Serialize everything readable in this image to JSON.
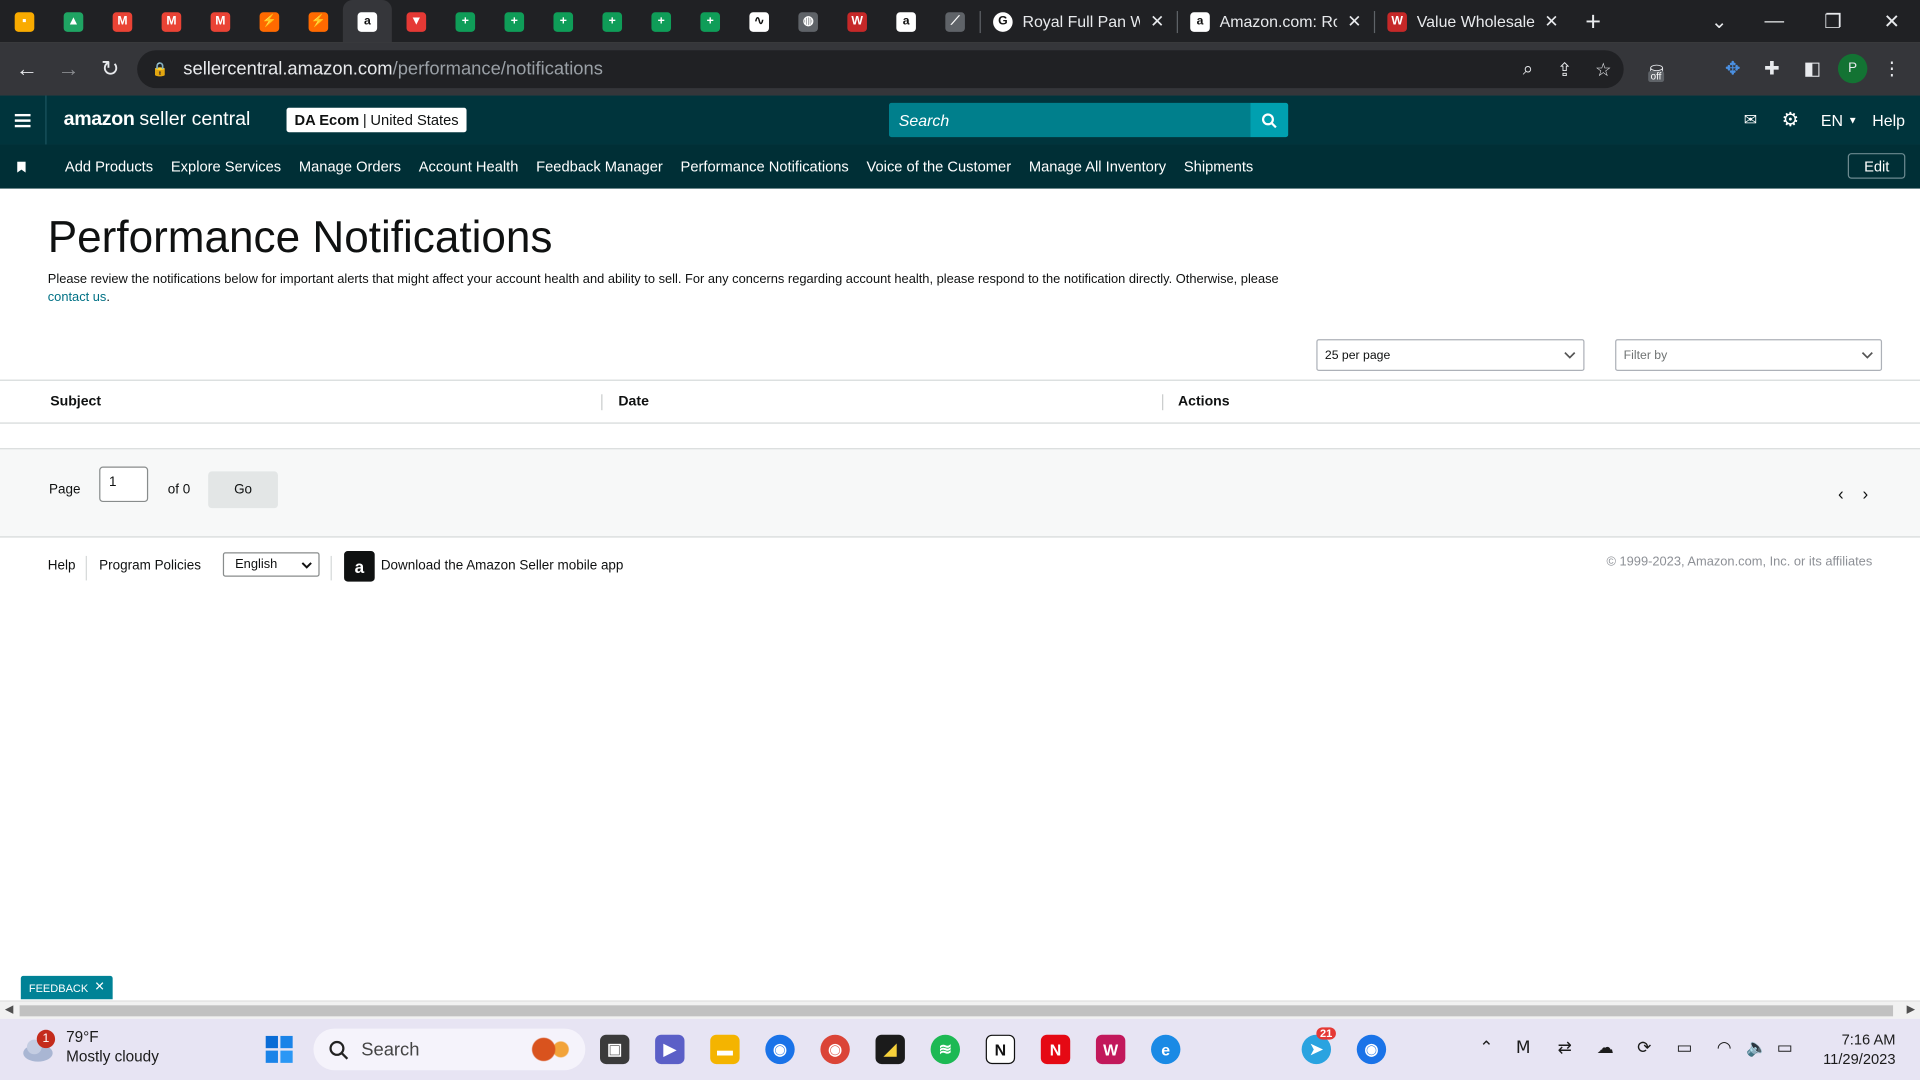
{
  "browser": {
    "pinned_tabs": [
      {
        "icon": "keep-icon",
        "color": "#f9ab00",
        "glyph": "▪"
      },
      {
        "icon": "google-drive-icon",
        "color": "#1fa463",
        "glyph": "▲"
      },
      {
        "icon": "gmail-icon",
        "color": "#ea4335",
        "glyph": "M"
      },
      {
        "icon": "gmail-icon",
        "color": "#ea4335",
        "glyph": "M"
      },
      {
        "icon": "gmail-icon",
        "color": "#ea4335",
        "glyph": "M"
      },
      {
        "icon": "app-bolt-icon",
        "color": "#ff6a00",
        "glyph": "⚡"
      },
      {
        "icon": "app-bolt-icon",
        "color": "#ff6a00",
        "glyph": "⚡"
      },
      {
        "icon": "amazon-icon",
        "color": "#ffffff",
        "glyph": "a"
      },
      {
        "icon": "app-red-icon",
        "color": "#e53935",
        "glyph": "▼"
      },
      {
        "icon": "google-sheets-icon",
        "color": "#0f9d58",
        "glyph": "+"
      },
      {
        "icon": "google-sheets-icon",
        "color": "#0f9d58",
        "glyph": "+"
      },
      {
        "icon": "google-sheets-icon",
        "color": "#0f9d58",
        "glyph": "+"
      },
      {
        "icon": "google-sheets-icon",
        "color": "#0f9d58",
        "glyph": "+"
      },
      {
        "icon": "google-sheets-icon",
        "color": "#0f9d58",
        "glyph": "+"
      },
      {
        "icon": "google-sheets-icon",
        "color": "#0f9d58",
        "glyph": "+"
      },
      {
        "icon": "app-chart-icon",
        "color": "#ffffff",
        "glyph": "∿"
      },
      {
        "icon": "globe-icon",
        "color": "#5f6368",
        "glyph": "◍"
      },
      {
        "icon": "value-wholesale-icon",
        "color": "#c62828",
        "glyph": "W"
      },
      {
        "icon": "amazon-icon",
        "color": "#ffffff",
        "glyph": "a"
      },
      {
        "icon": "app-graph-icon",
        "color": "#5f6368",
        "glyph": "⟋"
      }
    ],
    "tabs": [
      {
        "title": "Royal Full Pan Wh",
        "icon": "google-icon"
      },
      {
        "title": "Amazon.com: Ro",
        "icon": "amazon-icon"
      },
      {
        "title": "Value Wholesale",
        "icon": "value-wholesale-icon"
      }
    ],
    "url_host": "sellercentral.amazon.com",
    "url_path": "/performance/notifications",
    "extension_badge": "off",
    "profile_initial": "P"
  },
  "header": {
    "logo_bold": "amazon",
    "logo_rest": "seller central",
    "account_name": "DA Ecom",
    "account_region": "United States",
    "search_placeholder": "Search",
    "language": "EN",
    "help": "Help"
  },
  "nav": {
    "items": [
      "Add Products",
      "Explore Services",
      "Manage Orders",
      "Account Health",
      "Feedback Manager",
      "Performance Notifications",
      "Voice of the Customer",
      "Manage All Inventory",
      "Shipments"
    ],
    "edit": "Edit"
  },
  "page": {
    "title": "Performance Notifications",
    "description": "Please review the notifications below for important alerts that might affect your account health and ability to sell. For any concerns regarding account health, please respond to the notification directly. Otherwise, please",
    "contact_link": "contact us",
    "per_page": "25 per page",
    "filter_placeholder": "Filter by",
    "columns": [
      "Subject",
      "Date",
      "Actions"
    ]
  },
  "pager": {
    "page_label": "Page",
    "page_value": "1",
    "of_label": "of 0",
    "go": "Go"
  },
  "footer": {
    "help": "Help",
    "policies": "Program Policies",
    "language": "English",
    "app_text": "Download the Amazon Seller mobile app",
    "copyright": "© 1999-2023, Amazon.com, Inc. or its affiliates"
  },
  "feedback": "FEEDBACK",
  "taskbar": {
    "weather_temp": "79°F",
    "weather_desc": "Mostly cloudy",
    "weather_badge": "1",
    "search": "Search",
    "telegram_badge": "21",
    "time": "7:16 AM",
    "date": "11/29/2023"
  }
}
